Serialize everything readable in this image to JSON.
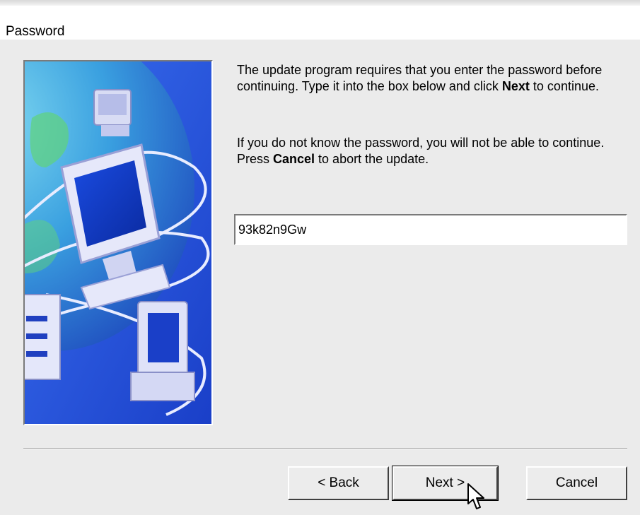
{
  "window": {
    "title": "Password"
  },
  "content": {
    "paragraph1": {
      "part1": "The update program requires that you enter the password before continuing.  Type it into the box below and click ",
      "bold": "Next",
      "part2": " to continue."
    },
    "paragraph2": {
      "part1": "If you do not know the password, you will not be able to continue.  Press ",
      "bold": "Cancel",
      "part2": " to abort the update."
    },
    "password_value": "93k82n9Gw"
  },
  "buttons": {
    "back": "< Back",
    "next": "Next >",
    "cancel": "Cancel"
  },
  "colors": {
    "art_background": "#1f57e0",
    "dialog_background": "#ebebeb"
  }
}
